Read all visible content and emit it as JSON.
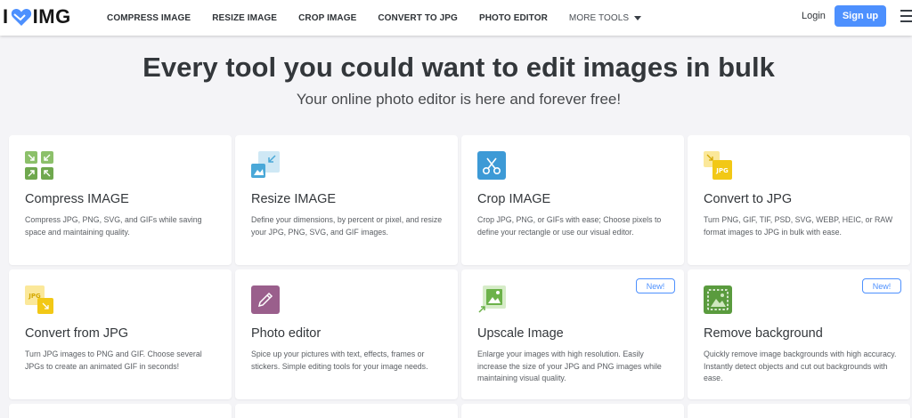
{
  "header": {
    "logo_left": "I",
    "logo_right": "IMG",
    "nav": [
      {
        "label": "COMPRESS IMAGE"
      },
      {
        "label": "RESIZE IMAGE"
      },
      {
        "label": "CROP IMAGE"
      },
      {
        "label": "CONVERT TO JPG"
      },
      {
        "label": "PHOTO EDITOR"
      }
    ],
    "more_tools": "MORE TOOLS",
    "login": "Login",
    "signup": "Sign up"
  },
  "hero": {
    "title": "Every tool you could want to edit images in bulk",
    "subtitle": "Your online photo editor is here and forever free!"
  },
  "tools": [
    {
      "title": "Compress IMAGE",
      "icon": "compress-icon",
      "badge": "",
      "desc": "Compress JPG, PNG, SVG, and GIFs while saving space and maintaining quality."
    },
    {
      "title": "Resize IMAGE",
      "icon": "resize-icon",
      "badge": "",
      "desc": "Define your dimensions, by percent or pixel, and resize your JPG, PNG, SVG, and GIF images."
    },
    {
      "title": "Crop IMAGE",
      "icon": "scissors-icon",
      "badge": "",
      "desc": "Crop JPG, PNG, or GIFs with ease; Choose pixels to define your rectangle or use our visual editor."
    },
    {
      "title": "Convert to JPG",
      "icon": "convert-to-jpg-icon",
      "badge": "",
      "desc": "Turn PNG, GIF, TIF, PSD, SVG, WEBP, HEIC, or RAW format images to JPG in bulk with ease."
    },
    {
      "title": "Convert from JPG",
      "icon": "convert-from-jpg-icon",
      "badge": "",
      "desc": "Turn JPG images to PNG and GIF. Choose several JPGs to create an animated GIF in seconds!"
    },
    {
      "title": "Photo editor",
      "icon": "pencil-icon",
      "badge": "",
      "desc": "Spice up your pictures with text, effects, frames or stickers. Simple editing tools for your image needs."
    },
    {
      "title": "Upscale Image",
      "icon": "upscale-icon",
      "badge": "New!",
      "desc": "Enlarge your images with high resolution. Easily increase the size of your JPG and PNG images while maintaining visual quality."
    },
    {
      "title": "Remove background",
      "icon": "remove-background-icon",
      "badge": "New!",
      "desc": "Quickly remove image backgrounds with high accuracy. Instantly detect objects and cut out backgrounds with ease."
    }
  ],
  "icon_labels": {
    "jpg_out": "JPG",
    "jpg_in": "JPG"
  },
  "colors": {
    "accent": "#4d90fe",
    "compress": "#6fa84e",
    "resize": "#4aa8d8",
    "crop": "#3d9ad6",
    "jpg": "#f2c816",
    "editor": "#9a5f8c",
    "upscale": "#6cb24a",
    "removebg": "#5a9b3e"
  }
}
